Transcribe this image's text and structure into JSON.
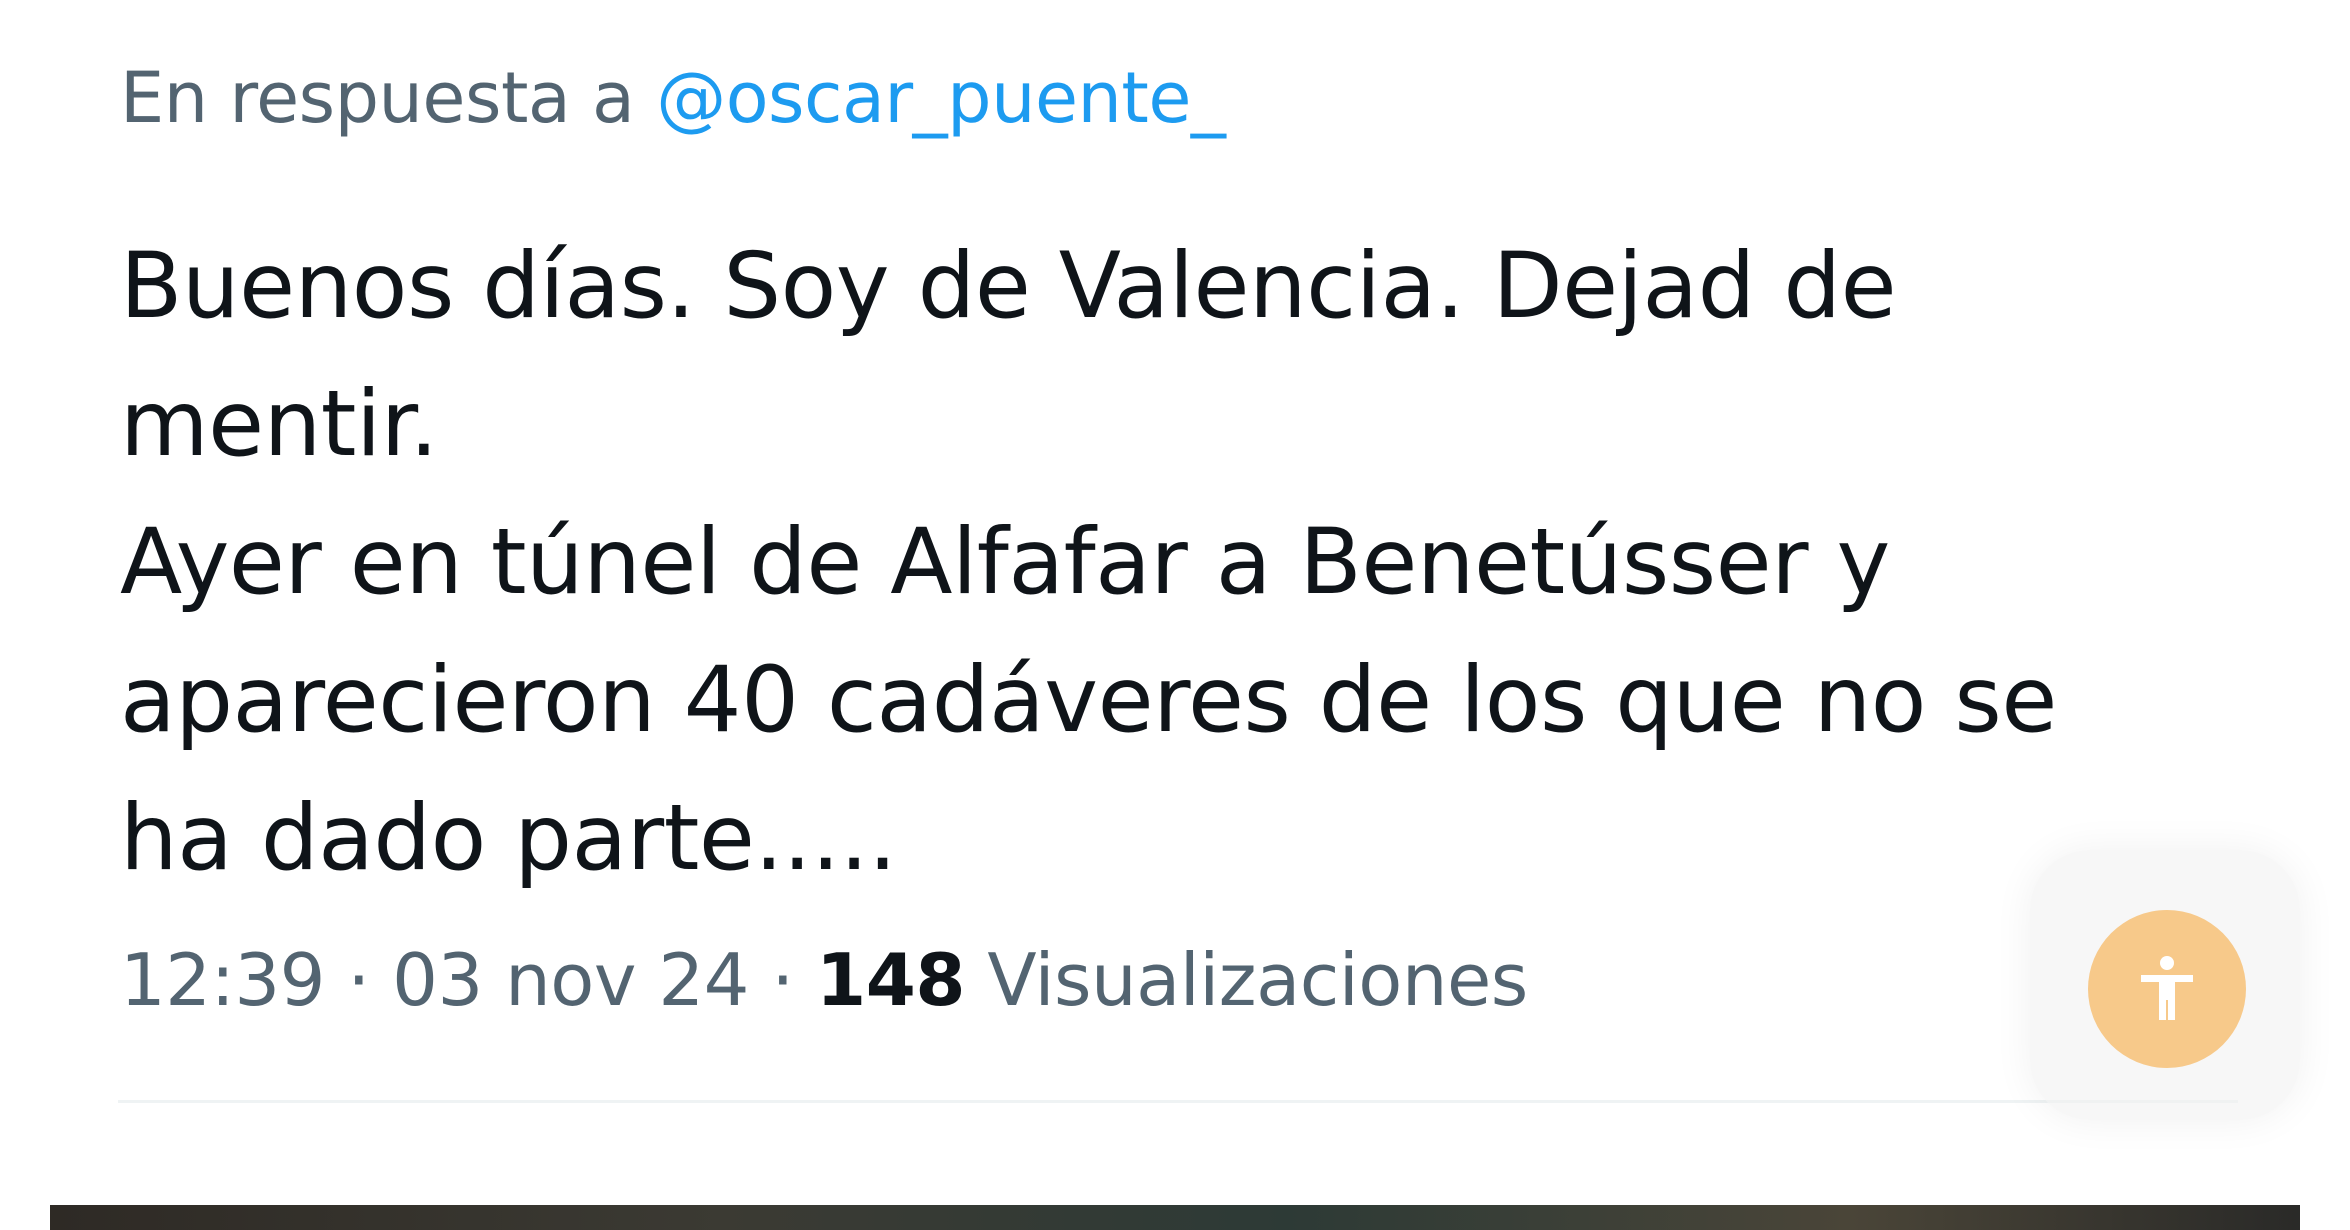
{
  "reply": {
    "prefix": "En respuesta a ",
    "handle": "@oscar_puente_"
  },
  "tweet": {
    "lines": [
      "Buenos días. Soy de Valencia. Dejad de",
      "mentir.",
      "Ayer en túnel de Alfafar a Benetússer y",
      "aparecieron 40 cadáveres de los que no se",
      "ha dado parte....."
    ]
  },
  "meta": {
    "time": "12:39",
    "separator": " · ",
    "date": "03 nov 24",
    "views_count": "148",
    "views_label": " Visualizaciones"
  },
  "icons": {
    "accessibility": "accessibility-person-icon"
  },
  "colors": {
    "text_primary": "#0f1419",
    "text_secondary": "#536471",
    "link": "#1d9bf0",
    "a11y_button": "#f7c98a"
  }
}
